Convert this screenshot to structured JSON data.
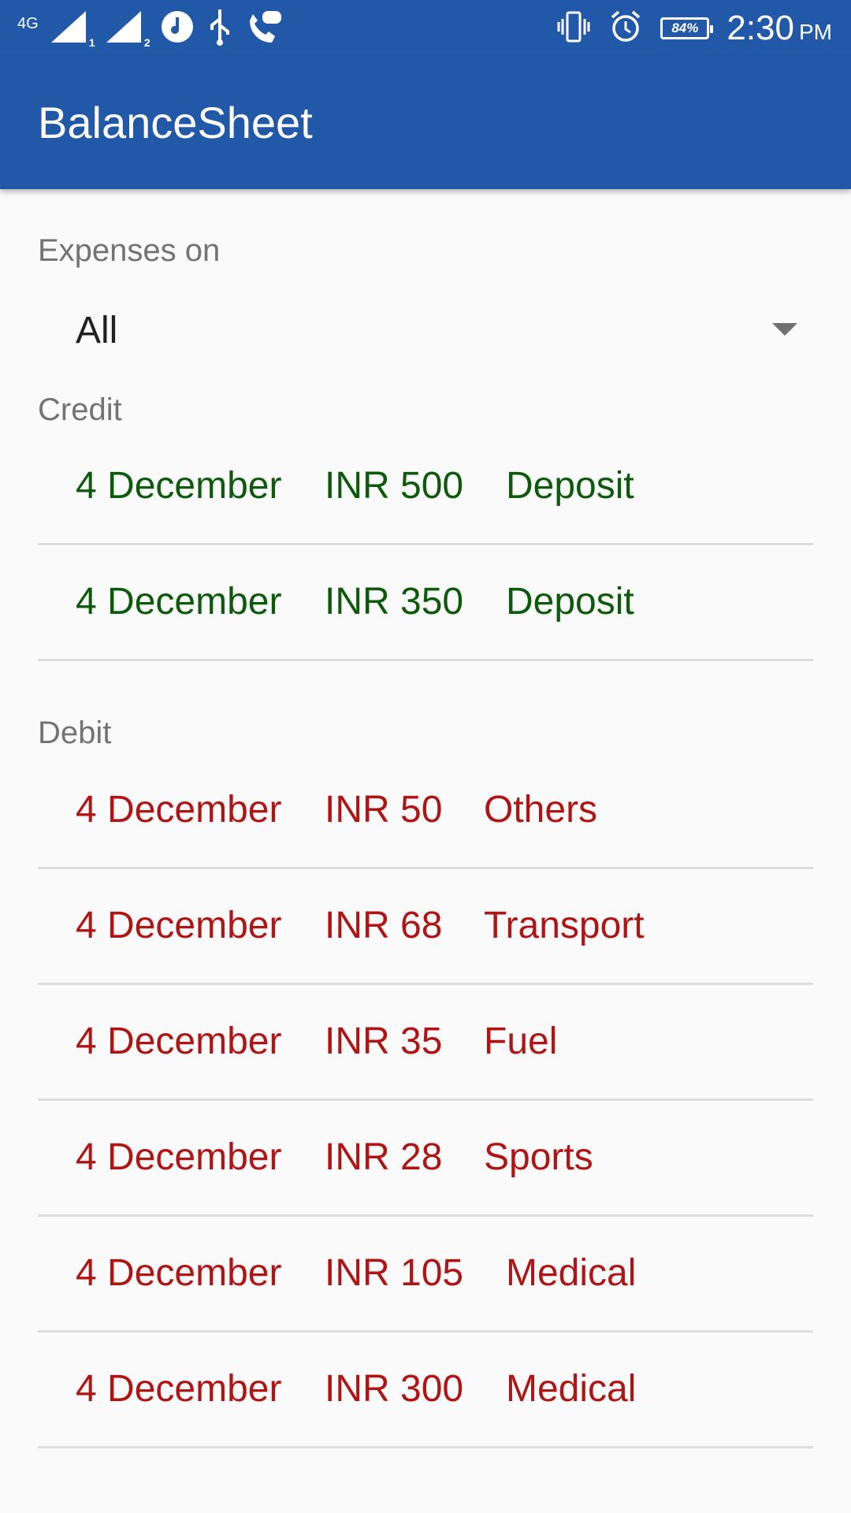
{
  "status_bar": {
    "network": "4G",
    "sim1": "1",
    "sim2": "2",
    "battery": "84%",
    "time": "2:30",
    "ampm": "PM"
  },
  "app": {
    "title": "BalanceSheet"
  },
  "filter": {
    "label": "Expenses on",
    "selected": "All"
  },
  "credit": {
    "label": "Credit",
    "rows": [
      {
        "date": "4 December",
        "amount": "INR 500",
        "category": "Deposit"
      },
      {
        "date": "4 December",
        "amount": "INR 350",
        "category": "Deposit"
      }
    ]
  },
  "debit": {
    "label": "Debit",
    "rows": [
      {
        "date": "4 December",
        "amount": "INR 50",
        "category": "Others"
      },
      {
        "date": "4 December",
        "amount": "INR 68",
        "category": "Transport"
      },
      {
        "date": "4 December",
        "amount": "INR 35",
        "category": "Fuel"
      },
      {
        "date": "4 December",
        "amount": "INR 28",
        "category": "Sports"
      },
      {
        "date": "4 December",
        "amount": "INR 105",
        "category": "Medical"
      },
      {
        "date": "4 December",
        "amount": "INR 300",
        "category": "Medical"
      }
    ]
  },
  "colors": {
    "app_bar": "#2159a8",
    "credit_text": "#0d5a0d",
    "debit_text": "#b01515",
    "label_text": "#737373",
    "divider": "#dddddd"
  }
}
